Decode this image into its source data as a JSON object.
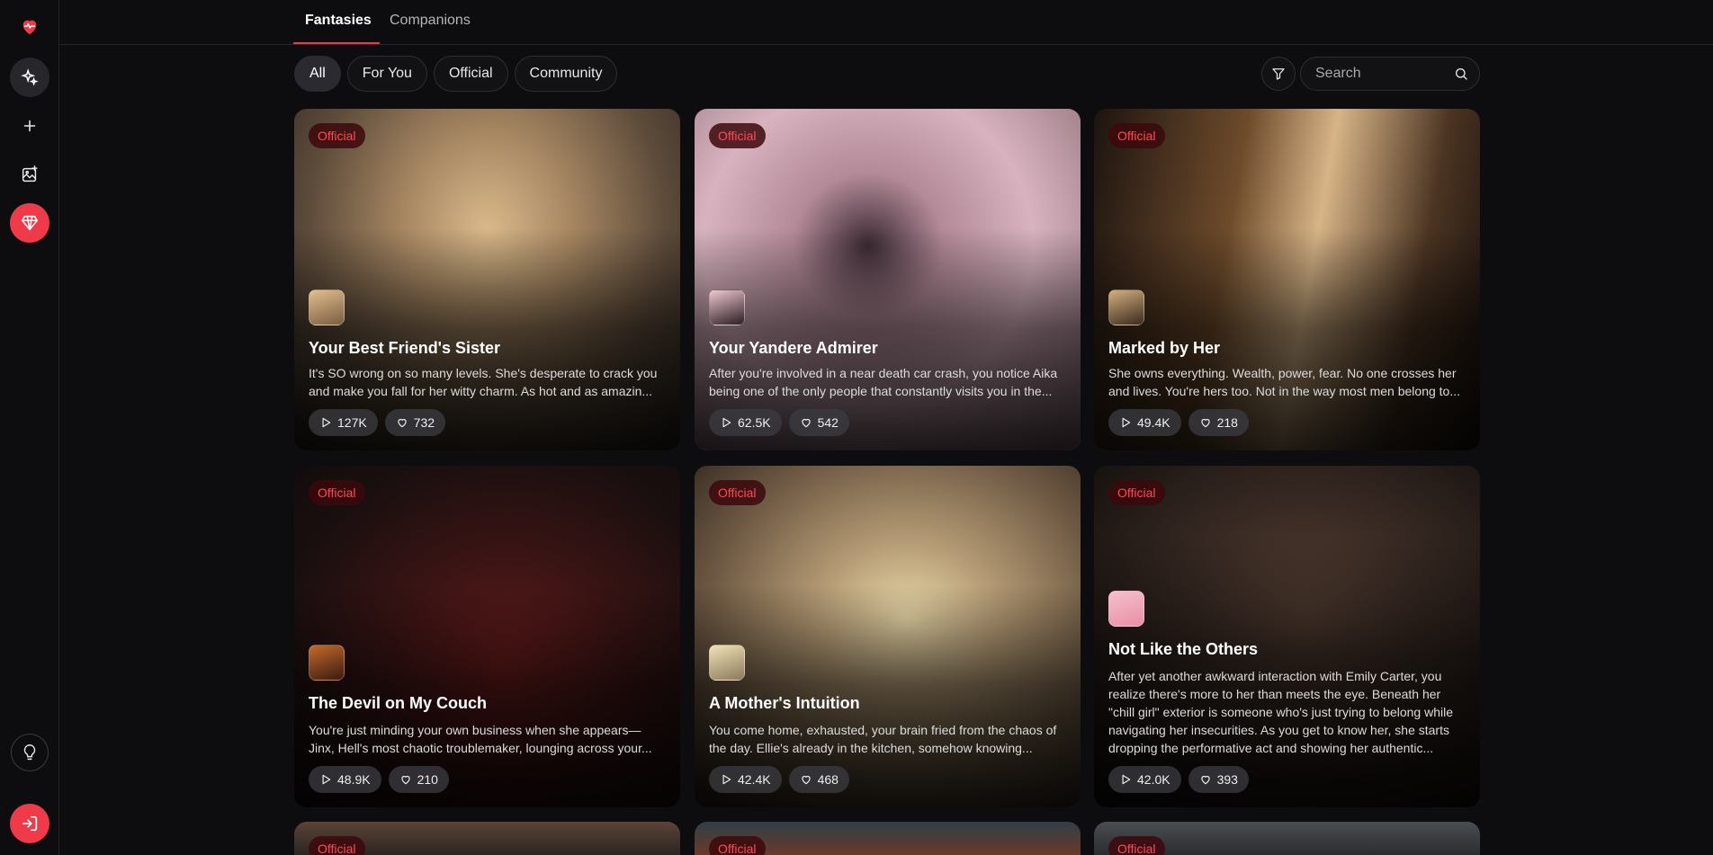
{
  "tabs": [
    {
      "label": "Fantasies",
      "active": true
    },
    {
      "label": "Companions",
      "active": false
    }
  ],
  "filters": [
    {
      "label": "All",
      "active": true
    },
    {
      "label": "For You",
      "active": false
    },
    {
      "label": "Official",
      "active": false
    },
    {
      "label": "Community",
      "active": false
    }
  ],
  "search": {
    "placeholder": "Search"
  },
  "colors": {
    "accent": "#ef3a4a",
    "badge_text": "#ff4a55",
    "background": "#0d0d0f"
  },
  "sidebar": {
    "icons": [
      "heart-pulse-icon",
      "sparkles-icon",
      "plus-icon",
      "image-plus-icon",
      "gem-icon",
      "lightbulb-icon",
      "login-icon"
    ]
  },
  "cards": [
    {
      "badge": "Official",
      "title": "Your Best Friend's Sister",
      "description": "It's SO wrong on so many levels. She's desperate to crack you and make you fall for her witty charm. As hot and as amazin...",
      "plays": "127K",
      "likes": "732"
    },
    {
      "badge": "Official",
      "title": "Your Yandere Admirer",
      "description": "After you're involved in a near death car crash, you notice Aika being one of the only people that constantly visits you in the...",
      "plays": "62.5K",
      "likes": "542"
    },
    {
      "badge": "Official",
      "title": "Marked by Her",
      "description": "She owns everything. Wealth, power, fear. No one crosses her and lives. You're hers too. Not in the way most men belong to...",
      "plays": "49.4K",
      "likes": "218"
    },
    {
      "badge": "Official",
      "title": "The Devil on My Couch",
      "description": "You're just minding your own business when she appears—Jinx, Hell's most chaotic troublemaker, lounging across your...",
      "plays": "48.9K",
      "likes": "210"
    },
    {
      "badge": "Official",
      "title": "A Mother's Intuition",
      "description": "You come home, exhausted, your brain fried from the chaos of the day. Ellie's already in the kitchen, somehow knowing...",
      "plays": "42.4K",
      "likes": "468"
    },
    {
      "badge": "Official",
      "title": "Not Like the Others",
      "description": "After yet another awkward interaction with Emily Carter, you realize there's more to her than meets the eye. Beneath her \"chill girl\" exterior is someone who's just trying to belong while navigating her insecurities. As you get to know her, she starts dropping the performative act and showing her authentic...",
      "plays": "42.0K",
      "likes": "393"
    },
    {
      "badge": "Official"
    },
    {
      "badge": "Official"
    },
    {
      "badge": "Official"
    }
  ]
}
